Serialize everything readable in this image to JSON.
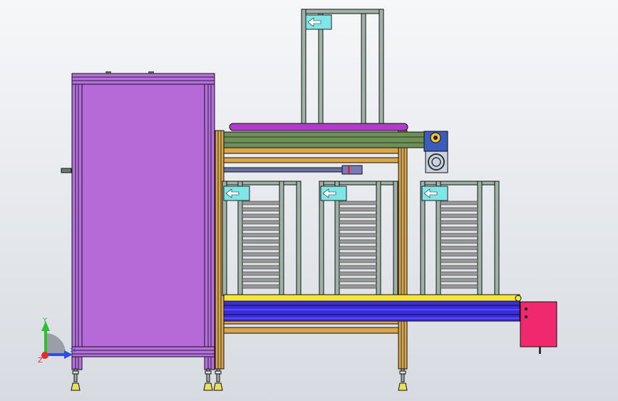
{
  "viewport": {
    "background_top": "#f6f7f9",
    "background_bottom": "#d7dbe1"
  },
  "colors": {
    "frame_purple": "#b56be0",
    "panel_purple": "#b56ad8",
    "profile_orange": "#d9a64a",
    "profile_green": "#6e8f58",
    "roller_magenta": "#b03cc8",
    "conveyor_blue": "#3a2ce0",
    "belt_yellow": "#f5e63c",
    "motor_blue": "#3b5cb8",
    "cabinet_pink": "#f0286e",
    "stop_cyan": "#7ee6e6",
    "tray_gray": "#9a9a9a"
  },
  "axis_triad": {
    "y_label": "Y",
    "x_label": "X",
    "z_label": "Z",
    "y_color": "#2fbf2f",
    "x_color": "#2f4fe0",
    "z_color": "#e02f2f"
  },
  "stop_icon": "arrow-left-icon"
}
